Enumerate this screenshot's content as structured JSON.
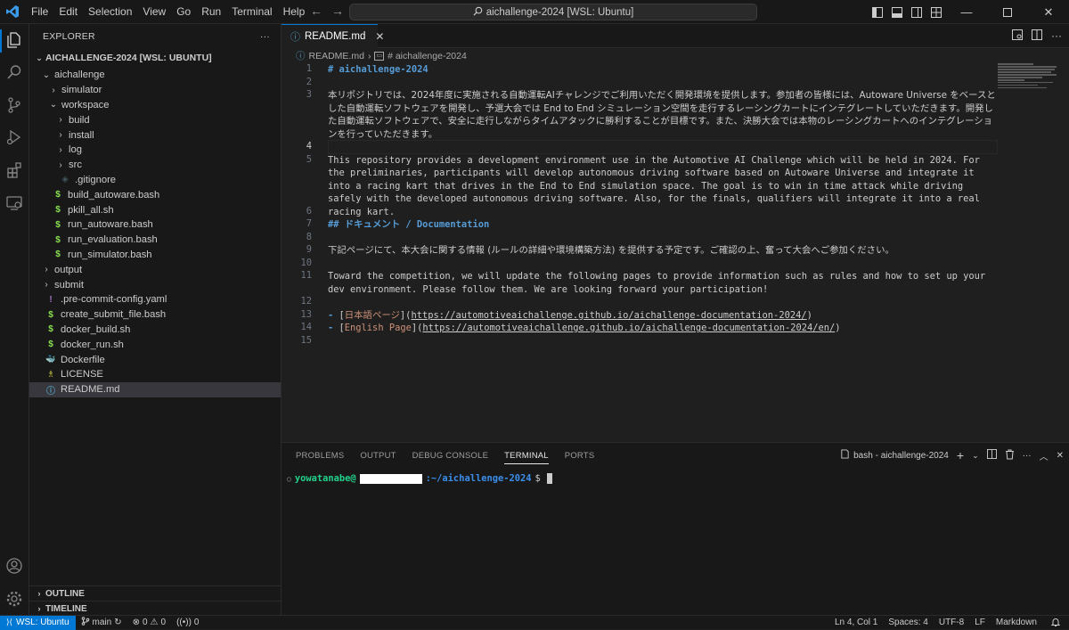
{
  "menu": [
    "File",
    "Edit",
    "Selection",
    "View",
    "Go",
    "Run",
    "Terminal",
    "Help"
  ],
  "command_center": {
    "text": "aichallenge-2024 [WSL: Ubuntu]"
  },
  "colors": {
    "accent": "#0078d4",
    "heading": "#569cd6",
    "link_text": "#ce9178",
    "term_user": "#23d18b",
    "term_path": "#3b8eea"
  },
  "explorer": {
    "title": "EXPLORER",
    "root": "AICHALLENGE-2024 [WSL: UBUNTU]",
    "items": [
      {
        "label": "aichallenge",
        "type": "folder-open",
        "depth": 1
      },
      {
        "label": "simulator",
        "type": "folder",
        "depth": 2
      },
      {
        "label": "workspace",
        "type": "folder-open",
        "depth": 2
      },
      {
        "label": "build",
        "type": "folder",
        "depth": 3
      },
      {
        "label": "install",
        "type": "folder",
        "depth": 3
      },
      {
        "label": "log",
        "type": "folder",
        "depth": 3
      },
      {
        "label": "src",
        "type": "folder",
        "depth": 3
      },
      {
        "label": ".gitignore",
        "type": "git",
        "depth": 3
      },
      {
        "label": "build_autoware.bash",
        "type": "shell",
        "depth": 2
      },
      {
        "label": "pkill_all.sh",
        "type": "shell",
        "depth": 2
      },
      {
        "label": "run_autoware.bash",
        "type": "shell",
        "depth": 2
      },
      {
        "label": "run_evaluation.bash",
        "type": "shell",
        "depth": 2
      },
      {
        "label": "run_simulator.bash",
        "type": "shell",
        "depth": 2
      },
      {
        "label": "output",
        "type": "folder",
        "depth": 1
      },
      {
        "label": "submit",
        "type": "folder",
        "depth": 1
      },
      {
        "label": ".pre-commit-config.yaml",
        "type": "yaml",
        "depth": 1
      },
      {
        "label": "create_submit_file.bash",
        "type": "shell",
        "depth": 1
      },
      {
        "label": "docker_build.sh",
        "type": "shell",
        "depth": 1
      },
      {
        "label": "docker_run.sh",
        "type": "shell",
        "depth": 1
      },
      {
        "label": "Dockerfile",
        "type": "docker",
        "depth": 1
      },
      {
        "label": "LICENSE",
        "type": "license",
        "depth": 1
      },
      {
        "label": "README.md",
        "type": "info",
        "depth": 1,
        "selected": true
      }
    ],
    "outline": "OUTLINE",
    "timeline": "TIMELINE"
  },
  "editor": {
    "tab": "README.md",
    "breadcrumb_file": "README.md",
    "breadcrumb_symbol": "# aichallenge-2024",
    "lines": {
      "l1": "# aichallenge-2024",
      "l3": "本リポジトリでは、2024年度に実施される自動運転AIチャレンジでご利用いただく開発環境を提供します。参加者の皆様には、Autoware Universe をベースとした自動運転ソフトウェアを開発し、予選大会では End to End シミュレーション空間を走行するレーシングカートにインテグレートしていただきます。開発した自動運転ソフトウェアで、安全に走行しながらタイムアタックに勝利することが目標です。また、決勝大会では本物のレーシングカートへのインテグレーションを行っていただきます。",
      "l5": "This repository provides a development environment use in the Automotive AI Challenge which will be held in 2024. For the preliminaries, participants will develop autonomous driving software based on Autoware Universe and integrate it into a racing kart that drives in the End to End simulation space. The goal is to win in time attack while driving safely with the developed autonomous driving software. Also, for the finals, qualifiers will integrate it into a real racing kart.",
      "l7_prefix": "## ",
      "l7": "ドキュメント / Documentation",
      "l9": "下記ページにて、本大会に関する情報 (ルールの詳細や環境構築方法) を提供する予定です。ご確認の上、奮って大会へご参加ください。",
      "l11": "Toward the competition, we will update the following pages to provide information such as rules and how to set up your dev environment. Please follow them. We are looking forward your participation!",
      "l13_dash": "- ",
      "l13_open": "[",
      "l13_text": "日本語ページ",
      "l13_mid": "](",
      "l13_url": "https://automotiveaichallenge.github.io/aichallenge-documentation-2024/",
      "l13_close": ")",
      "l14_dash": "- ",
      "l14_open": "[",
      "l14_text": "English Page",
      "l14_mid": "](",
      "l14_url": "https://automotiveaichallenge.github.io/aichallenge-documentation-2024/en/",
      "l14_close": ")"
    },
    "line_numbers": [
      "1",
      "2",
      "3",
      "4",
      "5",
      "6",
      "7",
      "8",
      "9",
      "10",
      "11",
      "12",
      "13",
      "14",
      "15"
    ]
  },
  "panel": {
    "tabs": [
      "PROBLEMS",
      "OUTPUT",
      "DEBUG CONSOLE",
      "TERMINAL",
      "PORTS"
    ],
    "active_tab": "TERMINAL",
    "terminal_name": "bash - aichallenge-2024",
    "prompt_user": "yowatanabe@",
    "prompt_path": ":~/aichallenge-2024",
    "prompt_symbol": "$"
  },
  "status": {
    "remote": "WSL: Ubuntu",
    "branch": "main",
    "errors": "0",
    "warnings": "0",
    "ports": "0",
    "position": "Ln 4, Col 1",
    "spaces": "Spaces: 4",
    "encoding": "UTF-8",
    "eol": "LF",
    "language": "Markdown"
  }
}
